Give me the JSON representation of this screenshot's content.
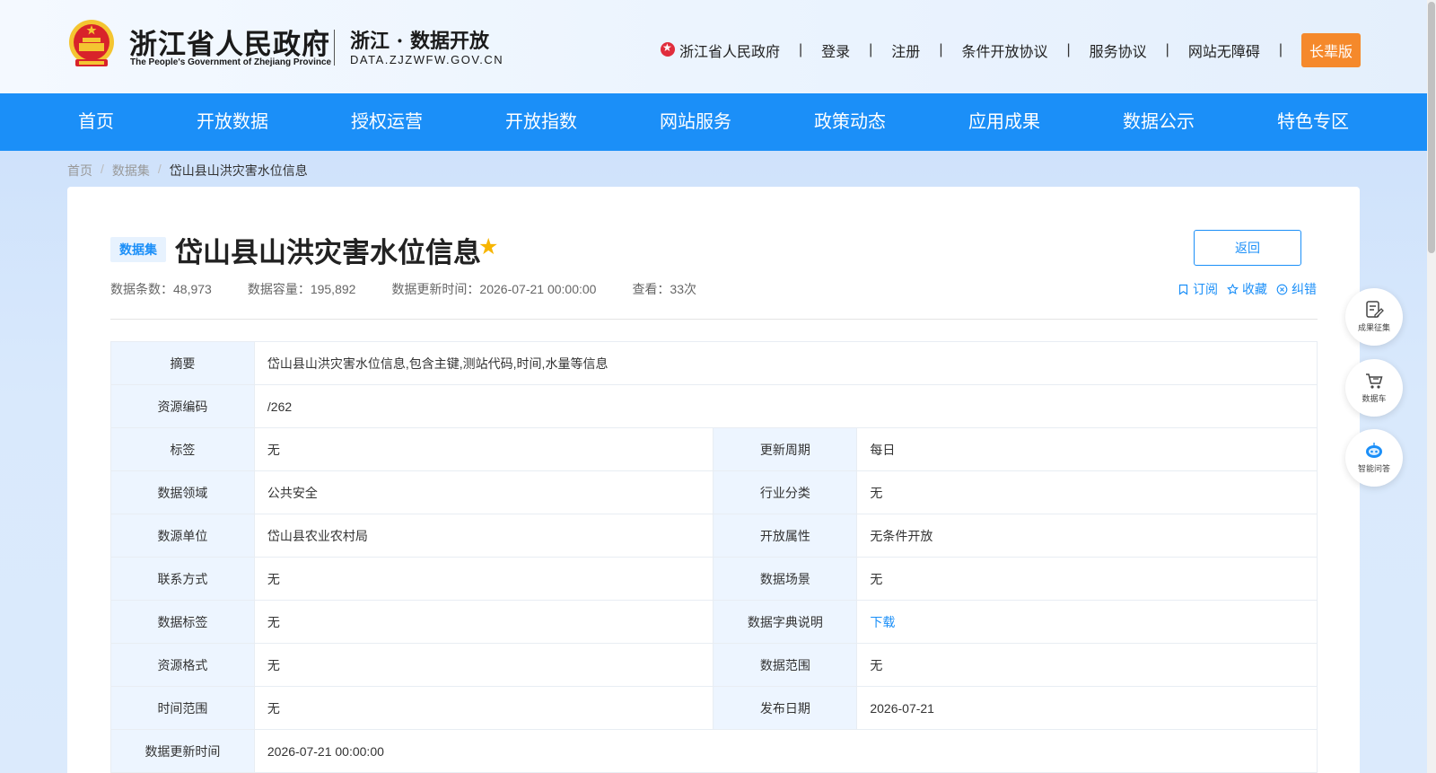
{
  "header": {
    "gov_title": "浙江省人民政府",
    "gov_subtitle": "The People's Government of Zhejiang Province",
    "site_name": "浙江 · 数据开放",
    "site_domain": "DATA.ZJZWFW.GOV.CN",
    "top_links": {
      "gov_portal": "浙江省人民政府",
      "login": "登录",
      "register": "注册",
      "conditional_agreement": "条件开放协议",
      "service_agreement": "服务协议",
      "accessibility": "网站无障碍",
      "elder_mode": "长辈版"
    },
    "separator": "|"
  },
  "nav": {
    "items": [
      {
        "label": "首页"
      },
      {
        "label": "开放数据"
      },
      {
        "label": "授权运营"
      },
      {
        "label": "开放指数"
      },
      {
        "label": "网站服务"
      },
      {
        "label": "政策动态"
      },
      {
        "label": "应用成果"
      },
      {
        "label": "数据公示"
      },
      {
        "label": "特色专区"
      }
    ]
  },
  "breadcrumb": {
    "home": "首页",
    "datasets": "数据集",
    "current": "岱山县山洪灾害水位信息",
    "separator": "/"
  },
  "dataset": {
    "badge": "数据集",
    "title": "岱山县山洪灾害水位信息",
    "back_label": "返回",
    "meta": {
      "record_count": "数据条数：48,973",
      "capacity": "数据容量：195,892",
      "updated": "数据更新时间：2026-07-21 00:00:00",
      "views": "查看：33次"
    },
    "actions": {
      "subscribe": "订阅",
      "favorite": "收藏",
      "report_error": "纠错"
    }
  },
  "info": {
    "summary_label": "摘要",
    "summary_value": "岱山县山洪灾害水位信息,包含主键,测站代码,时间,水量等信息",
    "resource_code_label": "资源编码",
    "resource_code_value": "/262",
    "tags_label": "标签",
    "tags_value": "无",
    "update_cycle_label": "更新周期",
    "update_cycle_value": "每日",
    "domain_label": "数据领域",
    "domain_value": "公共安全",
    "industry_label": "行业分类",
    "industry_value": "无",
    "source_label": "数源单位",
    "source_value": "岱山县农业农村局",
    "open_attr_label": "开放属性",
    "open_attr_value": "无条件开放",
    "contact_label": "联系方式",
    "contact_value": "无",
    "scene_label": "数据场景",
    "scene_value": "无",
    "data_tag_label": "数据标签",
    "data_tag_value": "无",
    "dictionary_label": "数据字典说明",
    "dictionary_value": "下载",
    "format_label": "资源格式",
    "format_value": "无",
    "range_label": "数据范围",
    "range_value": "无",
    "time_range_label": "时间范围",
    "time_range_value": "无",
    "publish_date_label": "发布日期",
    "publish_date_value": "2026-07-21",
    "last_update_label": "数据更新时间",
    "last_update_value": "2026-07-21 00:00:00"
  },
  "side_float": {
    "results": "成果征集",
    "cart": "数据车",
    "assistant": "智能问答"
  },
  "colors": {
    "primary": "#1b8ff8",
    "accent_orange": "#f5892b",
    "star": "#f7b500",
    "gov_red": "#e02d3c"
  }
}
